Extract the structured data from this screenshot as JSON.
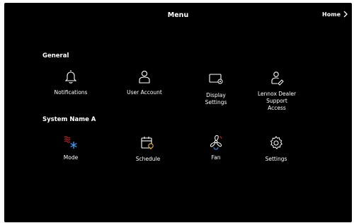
{
  "header": {
    "title": "Menu",
    "home_label": "Home"
  },
  "sections": [
    {
      "label": "General"
    },
    {
      "label": "System Name A"
    }
  ],
  "general_items": [
    {
      "label": "Notifications",
      "icon": "bell-icon"
    },
    {
      "label": "User Account",
      "icon": "user-icon"
    },
    {
      "label": "Display\nSettings",
      "icon": "display-settings-icon"
    },
    {
      "label": "Lennox Dealer\nSupport\nAccess",
      "icon": "dealer-support-icon"
    }
  ],
  "system_items": [
    {
      "label": "Mode",
      "icon": "mode-heat-cool-icon"
    },
    {
      "label": "Schedule",
      "icon": "schedule-icon"
    },
    {
      "label": "Fan",
      "icon": "fan-icon"
    },
    {
      "label": "Settings",
      "icon": "gear-icon"
    }
  ],
  "colors": {
    "background": "#000000",
    "text": "#ffffff",
    "heat": "#e02020",
    "cool": "#3aa0ff",
    "accent": "#f0b030"
  }
}
